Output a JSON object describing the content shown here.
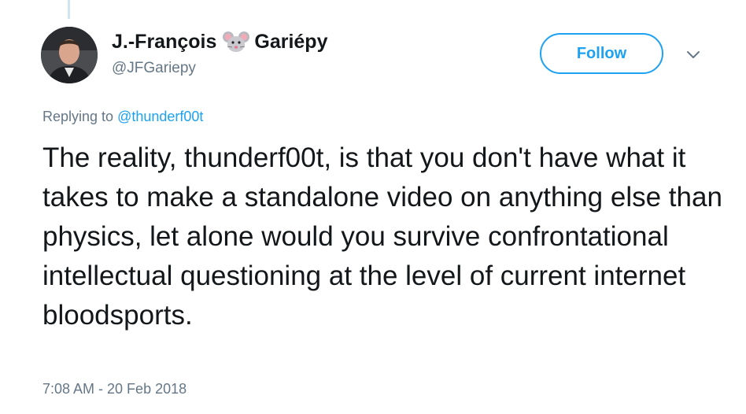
{
  "author": {
    "first_name": "J.-François",
    "last_name": "Gariépy",
    "name_emoji": "mouse-face-icon",
    "handle": "@JFGariepy"
  },
  "follow_button": {
    "label": "Follow"
  },
  "more_menu": {
    "icon": "chevron-down-icon"
  },
  "reply": {
    "prefix": "Replying to ",
    "target": "@thunderf00t"
  },
  "tweet": {
    "text": "The reality, thunderf00t, is that you don't have what it takes to make a standalone video on anything else than physics, let alone would you survive confrontational intellectual questioning at the level of current internet bloodsports.",
    "timestamp": "7:08 AM - 20 Feb 2018"
  },
  "colors": {
    "accent": "#1da1f2",
    "muted": "#657786",
    "text": "#14171a",
    "thread_line": "#cfe3f0"
  }
}
